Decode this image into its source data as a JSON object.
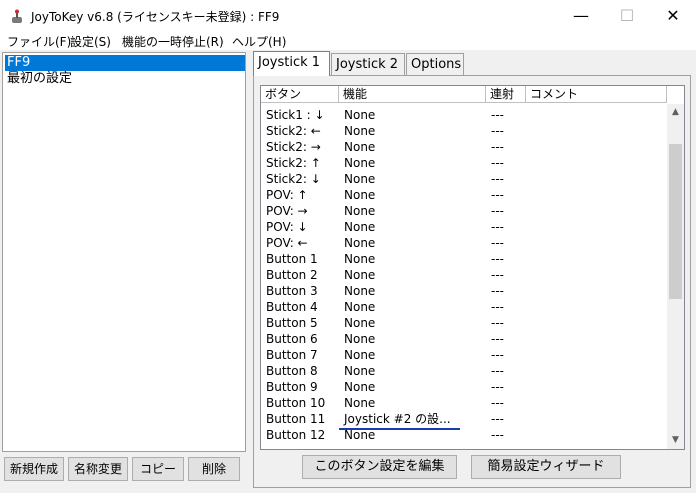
{
  "window": {
    "title": "JoyToKey v6.8 (ライセンスキー未登録) : FF9",
    "minimize": "—",
    "maximize": "☐",
    "close": "✕"
  },
  "menu": [
    "ファイル(F)",
    "設定(S)",
    "機能の一時停止(R)",
    "ヘルプ(H)"
  ],
  "profiles": [
    "FF9",
    "最初の設定"
  ],
  "left_buttons": [
    "新規作成",
    "名称変更",
    "コピー",
    "削除"
  ],
  "tabs": [
    "Joystick 1",
    "Joystick 2",
    "Options"
  ],
  "columns": [
    "ボタン",
    "機能",
    "連射",
    "コメント"
  ],
  "rows": [
    [
      "Stick1 : ↓",
      "None",
      "---"
    ],
    [
      "Stick2: ←",
      "None",
      "---"
    ],
    [
      "Stick2: →",
      "None",
      "---"
    ],
    [
      "Stick2: ↑",
      "None",
      "---"
    ],
    [
      "Stick2: ↓",
      "None",
      "---"
    ],
    [
      "POV: ↑",
      "None",
      "---"
    ],
    [
      "POV: →",
      "None",
      "---"
    ],
    [
      "POV: ↓",
      "None",
      "---"
    ],
    [
      "POV: ←",
      "None",
      "---"
    ],
    [
      "Button 1",
      "None",
      "---"
    ],
    [
      "Button 2",
      "None",
      "---"
    ],
    [
      "Button 3",
      "None",
      "---"
    ],
    [
      "Button 4",
      "None",
      "---"
    ],
    [
      "Button 5",
      "None",
      "---"
    ],
    [
      "Button 6",
      "None",
      "---"
    ],
    [
      "Button 7",
      "None",
      "---"
    ],
    [
      "Button 8",
      "None",
      "---"
    ],
    [
      "Button 9",
      "None",
      "---"
    ],
    [
      "Button 10",
      "None",
      "---"
    ],
    [
      "Button 11",
      "Joystick #2 の設...",
      "---"
    ],
    [
      "Button 12",
      "None",
      "---"
    ]
  ],
  "panel_buttons": [
    "このボタン設定を編集",
    "簡易設定ウィザード"
  ],
  "colors": {
    "selection": "#0078d7",
    "underline": "#1a3bb0"
  }
}
